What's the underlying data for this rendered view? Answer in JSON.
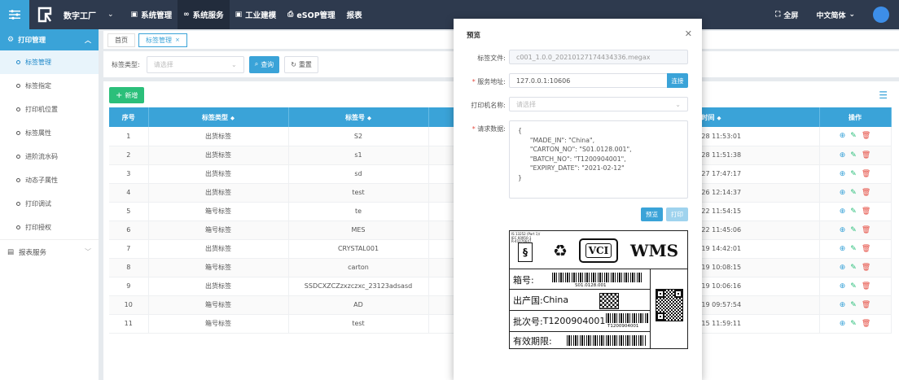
{
  "topbar": {
    "brand": "数字工厂",
    "nav": [
      {
        "label": "系统管理",
        "icon": "monitor-icon"
      },
      {
        "label": "系统服务",
        "icon": "infinity-icon"
      },
      {
        "label": "工业建模",
        "icon": "monitor-icon"
      },
      {
        "label": "eSOP管理",
        "icon": "printer-icon"
      },
      {
        "label": "报表",
        "icon": ""
      }
    ],
    "fullscreen": "全屏",
    "language": "中文简体"
  },
  "sidebar": {
    "group": "打印管理",
    "items": [
      "标签管理",
      "标签指定",
      "打印机位置",
      "标签属性",
      "进阶流水码",
      "动态子属性",
      "打印调试",
      "打印授权"
    ],
    "group2": "报表服务"
  },
  "tabs": [
    "首页",
    "标签管理"
  ],
  "filter": {
    "label": "标签类型:",
    "placeholder": "请选择",
    "query": "查询",
    "reset": "重置"
  },
  "table": {
    "add": "新增",
    "headers": [
      "序号",
      "标签类型",
      "标签号",
      "时间",
      "操作"
    ],
    "rows": [
      {
        "no": "1",
        "type": "出货标签",
        "code": "S2",
        "time": "-28 11:53:01"
      },
      {
        "no": "2",
        "type": "出货标签",
        "code": "s1",
        "time": "-28 11:51:38"
      },
      {
        "no": "3",
        "type": "出货标签",
        "code": "sd",
        "time": "-27 17:47:17"
      },
      {
        "no": "4",
        "type": "出货标签",
        "code": "test",
        "time": "-26 12:14:37"
      },
      {
        "no": "5",
        "type": "箱号标签",
        "code": "te",
        "time": "-22 11:54:15"
      },
      {
        "no": "6",
        "type": "箱号标签",
        "code": "MES",
        "time": "-22 11:45:06"
      },
      {
        "no": "7",
        "type": "出货标签",
        "code": "CRYSTAL001",
        "time": "-19 14:42:01"
      },
      {
        "no": "8",
        "type": "箱号标签",
        "code": "carton",
        "time": "-19 10:08:15"
      },
      {
        "no": "9",
        "type": "出货标签",
        "code": "SSDCXZCZzxzczxc_23123adsasd",
        "time": "-19 10:06:16"
      },
      {
        "no": "10",
        "type": "箱号标签",
        "code": "AD",
        "time": "-19 09:57:54"
      },
      {
        "no": "11",
        "type": "箱号标签",
        "code": "test",
        "time": "-15 11:59:11"
      }
    ]
  },
  "modal": {
    "title": "预览",
    "file_label": "标签文件:",
    "file_value": "c001_1.0.0_20210127174434336.megax",
    "service_label": "服务地址:",
    "service_value": "127.0.0.1:10606",
    "connect": "连接",
    "printer_label": "打印机名称:",
    "printer_placeholder": "请选择",
    "data_label": "请求数据:",
    "data_value": "{\n      \"MADE_IN\": \"China\",\n      \"CARTON_NO\": \"S01.0128.001\",\n      \"BATCH_NO\": \"T1200904001\",\n      \"EXPIRY_DATE\": \"2021-02-12\"\n}",
    "preview_btn": "预览",
    "print_btn": "打印"
  },
  "label": {
    "cert": "IS 13252 (Part 1)/\nIEC 60950-1\nR-41076647",
    "vci": "VCI",
    "wms": "WMS",
    "box_key": "箱号:",
    "box_code": "S01.0128.001",
    "origin_key": "出产国:",
    "origin_val": "China",
    "batch_key": "批次号:",
    "batch_val": "T1200904001",
    "batch_code": "T1200904001",
    "expiry_key": "有效期限:"
  }
}
